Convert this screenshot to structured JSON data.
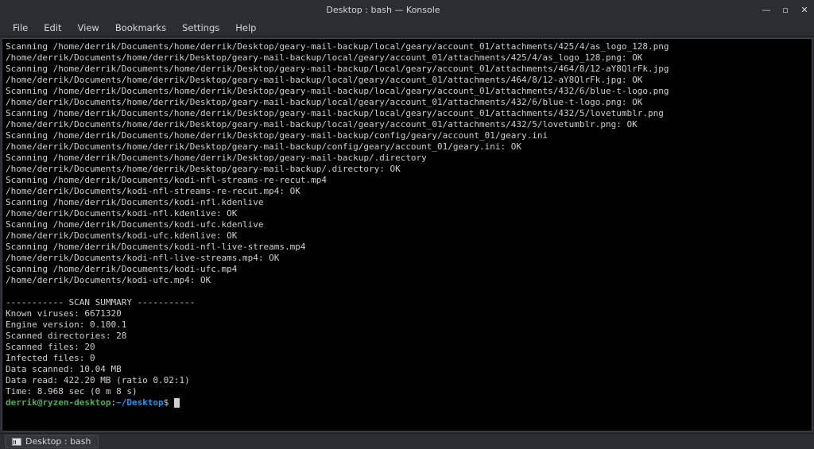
{
  "window": {
    "title": "Desktop : bash — Konsole"
  },
  "menu": {
    "file": "File",
    "edit": "Edit",
    "view": "View",
    "bookmarks": "Bookmarks",
    "settings": "Settings",
    "help": "Help"
  },
  "terminal": {
    "lines": [
      "Scanning /home/derrik/Documents/home/derrik/Desktop/geary-mail-backup/local/geary/account_01/attachments/425/4/as_logo_128.png",
      "/home/derrik/Documents/home/derrik/Desktop/geary-mail-backup/local/geary/account_01/attachments/425/4/as_logo_128.png: OK",
      "Scanning /home/derrik/Documents/home/derrik/Desktop/geary-mail-backup/local/geary/account_01/attachments/464/8/12-aY8QlrFk.jpg",
      "/home/derrik/Documents/home/derrik/Desktop/geary-mail-backup/local/geary/account_01/attachments/464/8/12-aY8QlrFk.jpg: OK",
      "Scanning /home/derrik/Documents/home/derrik/Desktop/geary-mail-backup/local/geary/account_01/attachments/432/6/blue-t-logo.png",
      "/home/derrik/Documents/home/derrik/Desktop/geary-mail-backup/local/geary/account_01/attachments/432/6/blue-t-logo.png: OK",
      "Scanning /home/derrik/Documents/home/derrik/Desktop/geary-mail-backup/local/geary/account_01/attachments/432/5/lovetumblr.png",
      "/home/derrik/Documents/home/derrik/Desktop/geary-mail-backup/local/geary/account_01/attachments/432/5/lovetumblr.png: OK",
      "Scanning /home/derrik/Documents/home/derrik/Desktop/geary-mail-backup/config/geary/account_01/geary.ini",
      "/home/derrik/Documents/home/derrik/Desktop/geary-mail-backup/config/geary/account_01/geary.ini: OK",
      "Scanning /home/derrik/Documents/home/derrik/Desktop/geary-mail-backup/.directory",
      "/home/derrik/Documents/home/derrik/Desktop/geary-mail-backup/.directory: OK",
      "Scanning /home/derrik/Documents/kodi-nfl-streams-re-recut.mp4",
      "/home/derrik/Documents/kodi-nfl-streams-re-recut.mp4: OK",
      "Scanning /home/derrik/Documents/kodi-nfl.kdenlive",
      "/home/derrik/Documents/kodi-nfl.kdenlive: OK",
      "Scanning /home/derrik/Documents/kodi-ufc.kdenlive",
      "/home/derrik/Documents/kodi-ufc.kdenlive: OK",
      "Scanning /home/derrik/Documents/kodi-nfl-live-streams.mp4",
      "/home/derrik/Documents/kodi-nfl-live-streams.mp4: OK",
      "Scanning /home/derrik/Documents/kodi-ufc.mp4",
      "/home/derrik/Documents/kodi-ufc.mp4: OK",
      "",
      "----------- SCAN SUMMARY -----------",
      "Known viruses: 6671320",
      "Engine version: 0.100.1",
      "Scanned directories: 28",
      "Scanned files: 20",
      "Infected files: 0",
      "Data scanned: 10.04 MB",
      "Data read: 422.20 MB (ratio 0.02:1)",
      "Time: 8.968 sec (0 m 8 s)"
    ],
    "prompt": {
      "user_host": "derrik@ryzen-desktop",
      "colon": ":",
      "path": "~/Desktop",
      "dollar": "$ "
    }
  },
  "tab": {
    "label": "Desktop : bash"
  }
}
